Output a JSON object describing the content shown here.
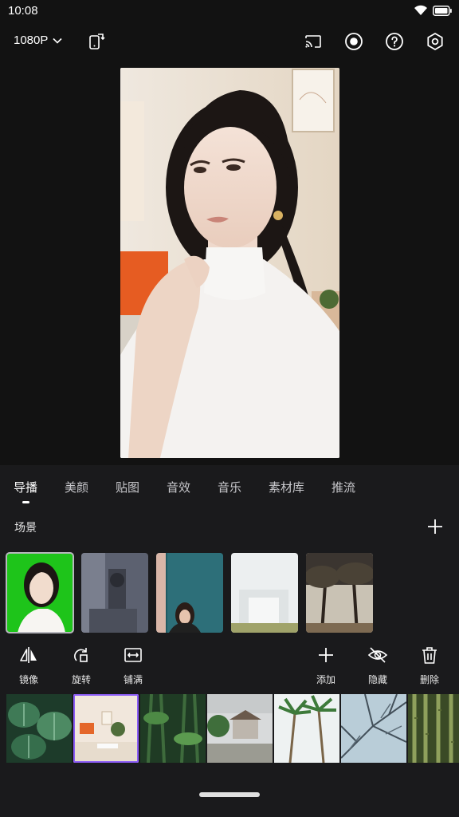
{
  "status": {
    "time": "10:08"
  },
  "toolbar": {
    "resolution": "1080P",
    "icons": [
      "phone-rotate-icon",
      "cast-icon",
      "record-icon",
      "help-icon",
      "settings-icon"
    ]
  },
  "tabs": [
    "导播",
    "美颜",
    "贴图",
    "音效",
    "音乐",
    "素材库",
    "推流"
  ],
  "active_tab": "导播",
  "scene_section": {
    "title": "场景"
  },
  "scenes": [
    {
      "name": "scene-portrait-green",
      "selected": true
    },
    {
      "name": "scene-gray-studio",
      "selected": false
    },
    {
      "name": "scene-teal-girl",
      "selected": false
    },
    {
      "name": "scene-white-arch",
      "selected": false
    },
    {
      "name": "scene-trees-sunset",
      "selected": false
    }
  ],
  "tools_left": [
    {
      "icon": "mirror-icon",
      "label": "镜像"
    },
    {
      "icon": "rotate-icon",
      "label": "旋转"
    },
    {
      "icon": "fill-icon",
      "label": "铺满"
    }
  ],
  "tools_right": [
    {
      "icon": "plus-icon",
      "label": "添加"
    },
    {
      "icon": "eye-off-icon",
      "label": "隐藏"
    },
    {
      "icon": "trash-icon",
      "label": "删除"
    }
  ],
  "materials": [
    {
      "name": "material-monstera-leaves",
      "selected": false
    },
    {
      "name": "material-bright-room",
      "selected": true
    },
    {
      "name": "material-bamboo-green",
      "selected": false
    },
    {
      "name": "material-courtyard",
      "selected": false
    },
    {
      "name": "material-palm-trees",
      "selected": false
    },
    {
      "name": "material-winter-branches",
      "selected": false
    },
    {
      "name": "material-bamboo-forest",
      "selected": false
    }
  ],
  "colors": {
    "accent": "#8b5cf6",
    "background": "#121212",
    "panel": "#1a1a1c"
  }
}
